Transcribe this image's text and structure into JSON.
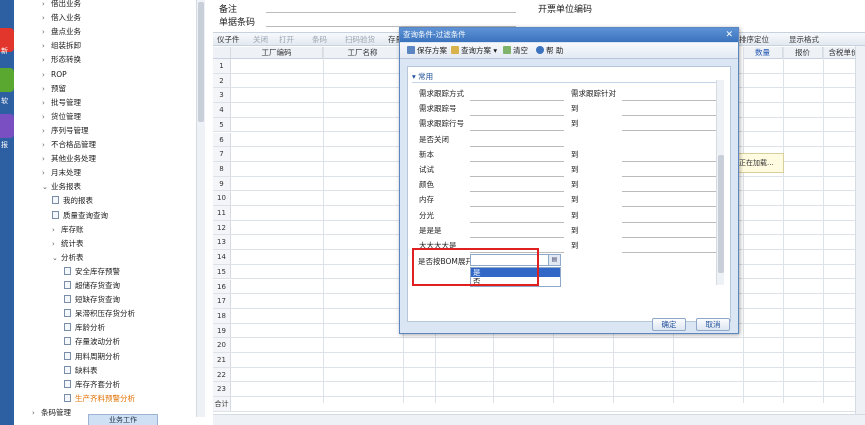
{
  "launcher": {
    "items": [
      {
        "label": "新",
        "color": "#e2352b"
      },
      {
        "label": "软",
        "color": "#5aa830"
      },
      {
        "label": "报",
        "color": "#7a4fc2"
      }
    ]
  },
  "nav": {
    "items": [
      {
        "label": "借出业务",
        "kind": "folder"
      },
      {
        "label": "借入业务",
        "kind": "folder"
      },
      {
        "label": "盘点业务",
        "kind": "folder"
      },
      {
        "label": "组装拆卸",
        "kind": "folder"
      },
      {
        "label": "形态转换",
        "kind": "folder"
      },
      {
        "label": "ROP",
        "kind": "folder"
      },
      {
        "label": "预留",
        "kind": "folder"
      },
      {
        "label": "批号管理",
        "kind": "folder"
      },
      {
        "label": "货位管理",
        "kind": "folder"
      },
      {
        "label": "序列号管理",
        "kind": "folder"
      },
      {
        "label": "不合格品管理",
        "kind": "folder"
      },
      {
        "label": "其他业务处理",
        "kind": "folder"
      },
      {
        "label": "月末处理",
        "kind": "folder"
      },
      {
        "label": "业务报表",
        "kind": "open"
      },
      {
        "label": "我的报表",
        "kind": "doc"
      },
      {
        "label": "质量查询查询",
        "kind": "doc"
      },
      {
        "label": "库存账",
        "kind": "folder2"
      },
      {
        "label": "统计表",
        "kind": "folder2"
      },
      {
        "label": "分析表",
        "kind": "open2"
      },
      {
        "label": "安全库存预警",
        "kind": "doc2"
      },
      {
        "label": "超储存货查询",
        "kind": "doc2"
      },
      {
        "label": "短缺存货查询",
        "kind": "doc2"
      },
      {
        "label": "呆滞积压存货分析",
        "kind": "doc2"
      },
      {
        "label": "库龄分析",
        "kind": "doc2"
      },
      {
        "label": "存量波动分析",
        "kind": "doc2"
      },
      {
        "label": "用料周期分析",
        "kind": "doc2"
      },
      {
        "label": "缺料表",
        "kind": "doc2"
      },
      {
        "label": "库存齐套分析",
        "kind": "doc2"
      },
      {
        "label": "生产齐料预警分析",
        "kind": "doc2",
        "active": true
      },
      {
        "label": "条码管理",
        "kind": "folder0"
      }
    ],
    "bottom_tab": "业务工作"
  },
  "header": {
    "remark_label": "备注",
    "barcode_label": "单据条码",
    "invoice_unit_label": "开票单位编码"
  },
  "toolbar": {
    "items": [
      "仪子件",
      "关闭",
      "打开",
      "显示格式",
      "条码",
      "扫码验货",
      "存量",
      "排序定位",
      "显示格式"
    ]
  },
  "grid": {
    "columns": [
      "工厂编码",
      "工厂名称",
      "数量",
      "报价",
      "含税单价"
    ],
    "rows": [
      "1",
      "2",
      "3",
      "4",
      "5",
      "6",
      "7",
      "8",
      "9",
      "10",
      "11",
      "12",
      "13",
      "14",
      "15",
      "16",
      "17",
      "18",
      "19",
      "20",
      "21",
      "22",
      "23"
    ],
    "total_label": "合计",
    "loading_text": "正在加载..."
  },
  "dialog": {
    "title": "查询条件-过滤条件",
    "tools": {
      "save_plan": "保存方案",
      "query_plan": "查询方案",
      "clear": "清空",
      "help": "帮 助"
    },
    "section": "常用",
    "rows": [
      {
        "label": "需求跟踪方式",
        "label2": "需求跟踪针对"
      },
      {
        "label": "需求跟踪号",
        "label2": "到"
      },
      {
        "label": "需求跟踪行号",
        "label2": "到"
      },
      {
        "label": "是否关闭",
        "label2": ""
      },
      {
        "label": "新本",
        "label2": "到"
      },
      {
        "label": "试试",
        "label2": "到"
      },
      {
        "label": "颜色",
        "label2": "到"
      },
      {
        "label": "内存",
        "label2": "到"
      },
      {
        "label": "分光",
        "label2": "到"
      },
      {
        "label": "是是是",
        "label2": "到"
      },
      {
        "label": "大大大大是",
        "label2": "到"
      }
    ],
    "bom_label": "是否按BOM展开",
    "bom_options": [
      "是",
      "否"
    ],
    "bom_selected": "是",
    "ok": "确定",
    "cancel": "取消"
  },
  "colors": {
    "accent": "#3a72bd",
    "highlight": "#e02020",
    "active_nav": "#e07000"
  }
}
